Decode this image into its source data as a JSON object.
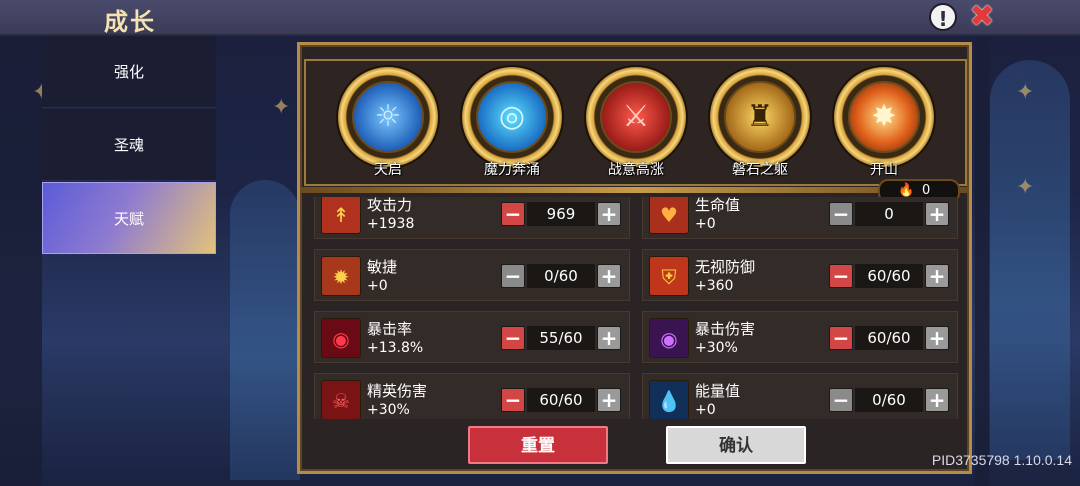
{
  "header": {
    "title": "成长",
    "help_icon": "help-icon",
    "close_icon": "close-icon"
  },
  "sidebar": {
    "items": [
      {
        "label": "强化",
        "active": false
      },
      {
        "label": "圣魂",
        "active": false
      },
      {
        "label": "天赋",
        "active": true
      }
    ]
  },
  "talents": [
    {
      "label": "天启",
      "icon": "ascension-icon",
      "color": "#4aa3ff"
    },
    {
      "label": "魔力奔涌",
      "icon": "mana-surge-icon",
      "color": "#3bb8ff"
    },
    {
      "label": "战意高涨",
      "icon": "battle-spirit-icon",
      "color": "#d8302a"
    },
    {
      "label": "磐石之躯",
      "icon": "stone-body-icon",
      "color": "#e0a030"
    },
    {
      "label": "开山",
      "icon": "mountain-split-icon",
      "color": "#ff8a2a"
    }
  ],
  "points": {
    "icon": "flame-icon",
    "value": "0"
  },
  "stats": [
    {
      "name": "攻击力",
      "bonus": "+1938",
      "value": "969",
      "icon": "sword-icon",
      "minus_active": true
    },
    {
      "name": "生命值",
      "bonus": "+0",
      "value": "0",
      "icon": "heart-icon",
      "minus_active": false
    },
    {
      "name": "敏捷",
      "bonus": "+0",
      "value": "0/60",
      "icon": "agility-icon",
      "minus_active": false
    },
    {
      "name": "无视防御",
      "bonus": "+360",
      "value": "60/60",
      "icon": "armor-break-icon",
      "minus_active": true
    },
    {
      "name": "暴击率",
      "bonus": "+13.8%",
      "value": "55/60",
      "icon": "crit-rate-icon",
      "minus_active": true
    },
    {
      "name": "暴击伤害",
      "bonus": "+30%",
      "value": "60/60",
      "icon": "crit-damage-icon",
      "minus_active": true
    },
    {
      "name": "精英伤害",
      "bonus": "+30%",
      "value": "60/60",
      "icon": "elite-damage-icon",
      "minus_active": true
    },
    {
      "name": "能量值",
      "bonus": "+0",
      "value": "0/60",
      "icon": "energy-icon",
      "minus_active": false
    }
  ],
  "buttons": {
    "reset": "重置",
    "confirm": "确认"
  },
  "footer": {
    "pid": "PID3735798 1.10.0.14"
  }
}
